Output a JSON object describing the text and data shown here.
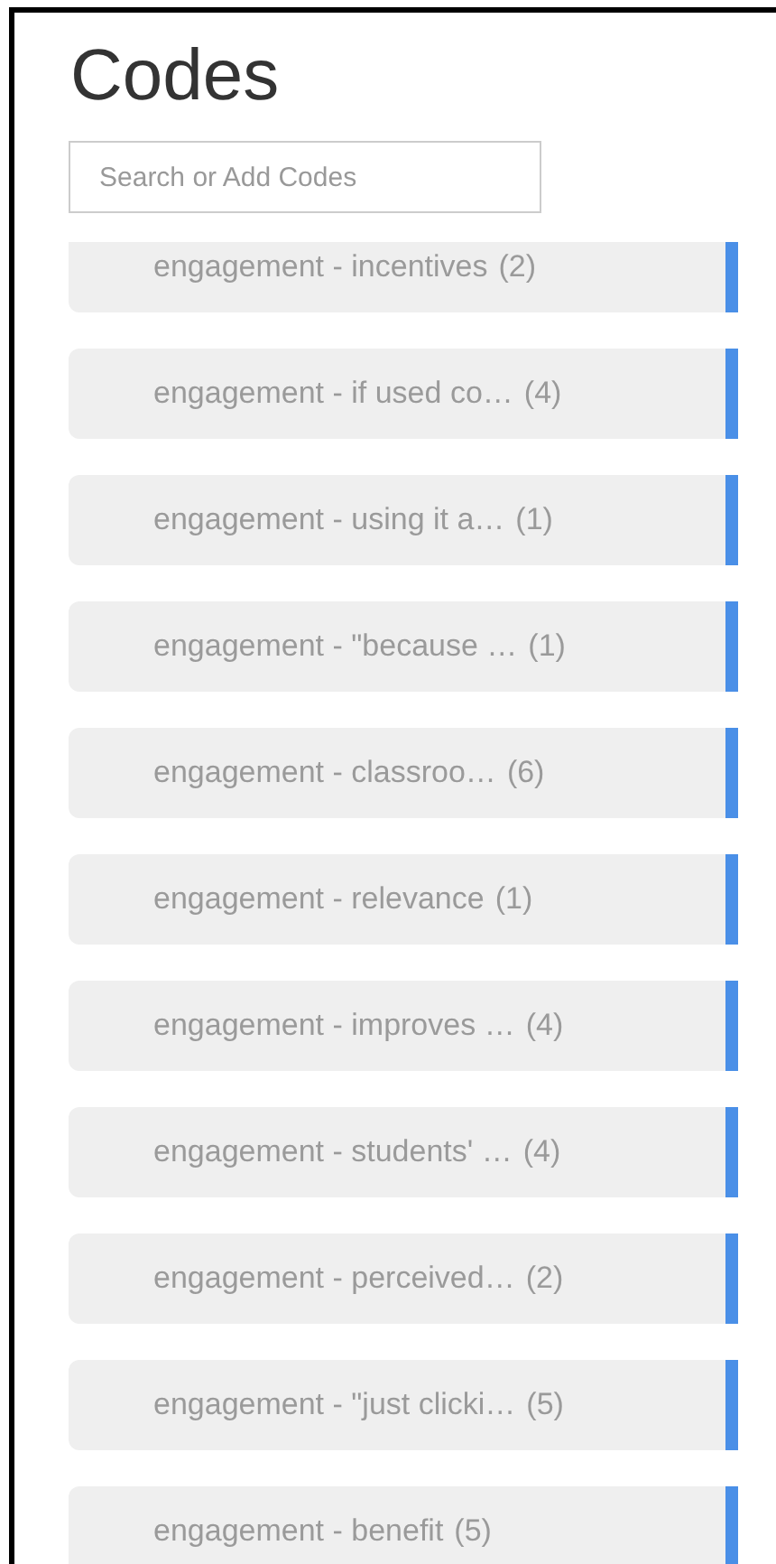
{
  "title": "Codes",
  "search": {
    "placeholder": "Search or Add Codes"
  },
  "codes": [
    {
      "name": "engagement - incentives",
      "count": "(2)"
    },
    {
      "name": "engagement - if used co…",
      "count": "(4)"
    },
    {
      "name": "engagement - using it a…",
      "count": "(1)"
    },
    {
      "name": "engagement - \"because …",
      "count": "(1)"
    },
    {
      "name": "engagement - classroo…",
      "count": "(6)"
    },
    {
      "name": "engagement - relevance",
      "count": "(1)"
    },
    {
      "name": "engagement - improves …",
      "count": "(4)"
    },
    {
      "name": "engagement - students' …",
      "count": "(4)"
    },
    {
      "name": "engagement - perceived…",
      "count": "(2)"
    },
    {
      "name": "engagement - \"just clicki…",
      "count": "(5)"
    },
    {
      "name": "engagement - benefit",
      "count": "(5)"
    }
  ]
}
